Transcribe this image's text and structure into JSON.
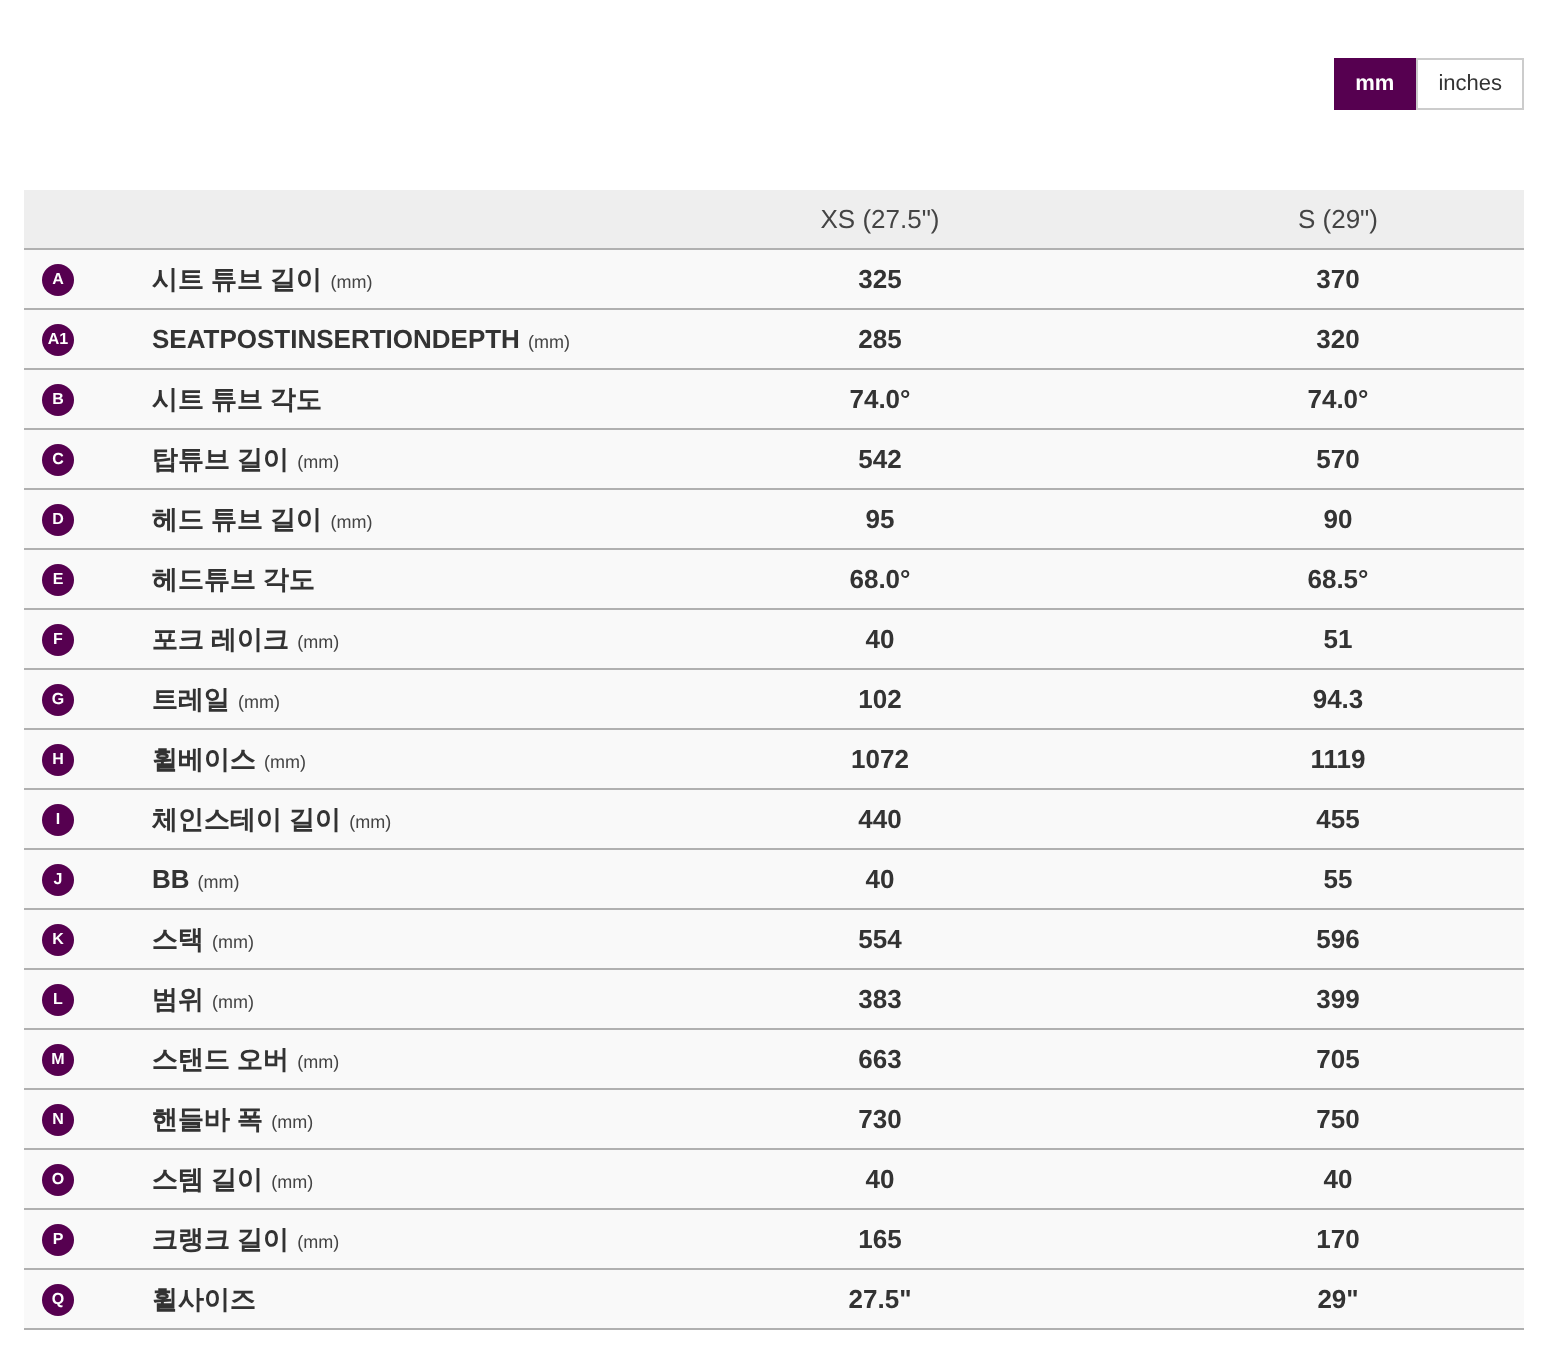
{
  "units": [
    {
      "label": "mm",
      "selected": true
    },
    {
      "label": "inches",
      "selected": false
    }
  ],
  "table": {
    "columns": [
      "XS (27.5\")",
      "S (29\")"
    ],
    "rows": [
      {
        "letter": "A",
        "name": "시트 튜브 길이",
        "unit": "(mm)",
        "values": [
          "325",
          "370"
        ]
      },
      {
        "letter": "A1",
        "name": "SEATPOSTINSERTIONDEPTH",
        "unit": "(mm)",
        "values": [
          "285",
          "320"
        ]
      },
      {
        "letter": "B",
        "name": "시트 튜브 각도",
        "values": [
          "74.0°",
          "74.0°"
        ]
      },
      {
        "letter": "C",
        "name": "탑튜브 길이",
        "unit": "(mm)",
        "values": [
          "542",
          "570"
        ]
      },
      {
        "letter": "D",
        "name": "헤드 튜브 길이",
        "unit": "(mm)",
        "values": [
          "95",
          "90"
        ]
      },
      {
        "letter": "E",
        "name": "헤드튜브 각도",
        "values": [
          "68.0°",
          "68.5°"
        ]
      },
      {
        "letter": "F",
        "name": "포크 레이크",
        "unit": "(mm)",
        "values": [
          "40",
          "51"
        ]
      },
      {
        "letter": "G",
        "name": "트레일",
        "unit": "(mm)",
        "values": [
          "102",
          "94.3"
        ]
      },
      {
        "letter": "H",
        "name": "휠베이스",
        "unit": "(mm)",
        "values": [
          "1072",
          "1119"
        ]
      },
      {
        "letter": "I",
        "name": "체인스테이 길이",
        "unit": "(mm)",
        "values": [
          "440",
          "455"
        ]
      },
      {
        "letter": "J",
        "name": "BB",
        "unit": "(mm)",
        "values": [
          "40",
          "55"
        ]
      },
      {
        "letter": "K",
        "name": "스택",
        "unit": "(mm)",
        "values": [
          "554",
          "596"
        ]
      },
      {
        "letter": "L",
        "name": "범위",
        "unit": "(mm)",
        "values": [
          "383",
          "399"
        ]
      },
      {
        "letter": "M",
        "name": "스탠드 오버",
        "unit": "(mm)",
        "values": [
          "663",
          "705"
        ]
      },
      {
        "letter": "N",
        "name": "핸들바 폭",
        "unit": "(mm)",
        "values": [
          "730",
          "750"
        ]
      },
      {
        "letter": "O",
        "name": "스템 길이",
        "unit": "(mm)",
        "values": [
          "40",
          "40"
        ]
      },
      {
        "letter": "P",
        "name": "크랭크 길이",
        "unit": "(mm)",
        "values": [
          "165",
          "170"
        ]
      },
      {
        "letter": "Q",
        "name": "휠사이즈",
        "values": [
          "27.5\"",
          "29\""
        ]
      }
    ]
  }
}
